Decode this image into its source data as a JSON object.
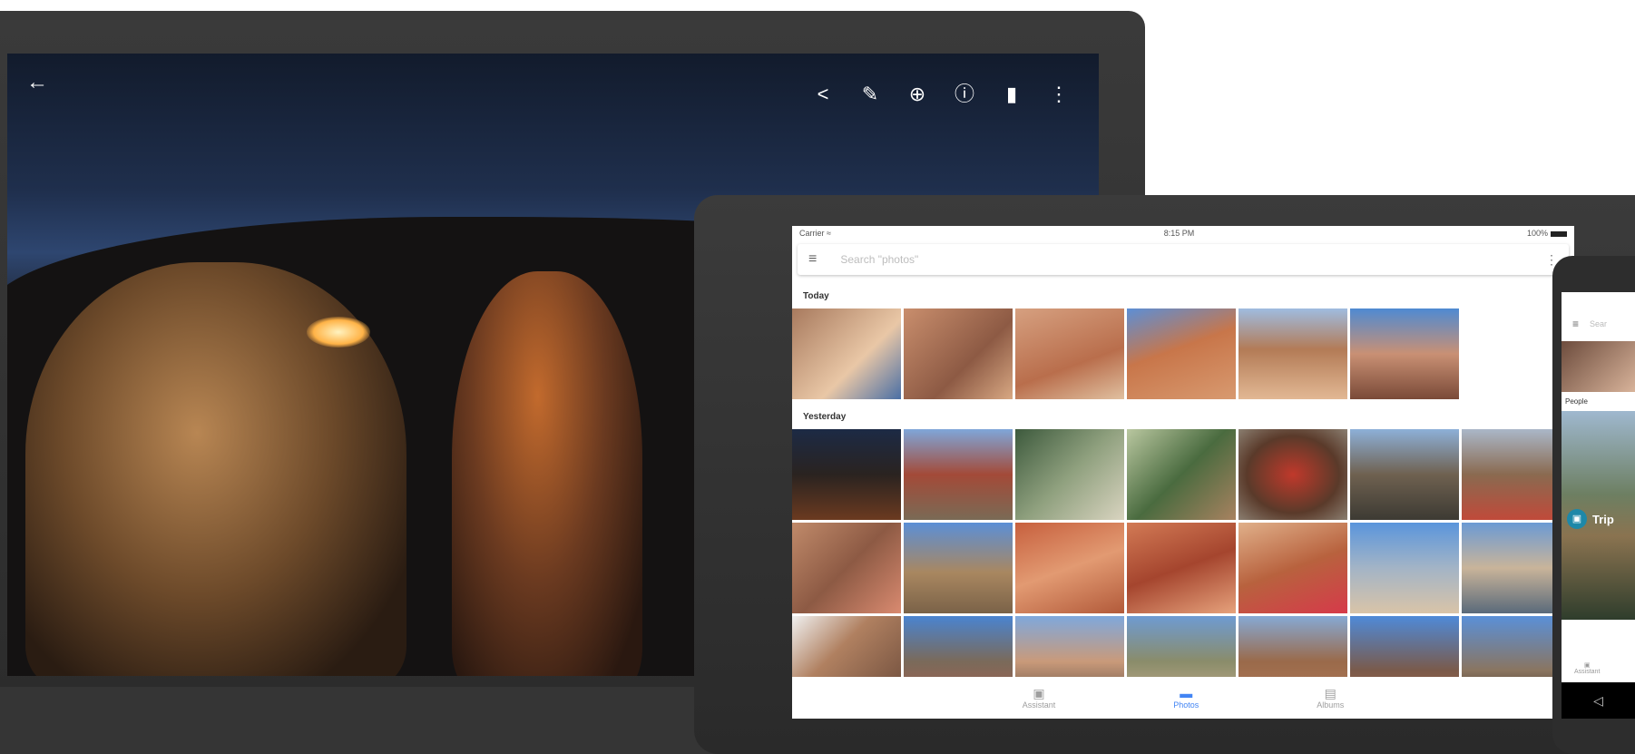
{
  "laptop": {
    "back_icon": "arrow-left-icon",
    "toolbar": [
      {
        "name": "share-icon",
        "glyph": "<"
      },
      {
        "name": "edit-icon",
        "glyph": "✎"
      },
      {
        "name": "zoom-icon",
        "glyph": "⊕"
      },
      {
        "name": "info-icon",
        "glyph": "ⓘ"
      },
      {
        "name": "delete-icon",
        "glyph": "▮"
      },
      {
        "name": "more-vert-icon",
        "glyph": "⋮"
      }
    ]
  },
  "tablet": {
    "status": {
      "carrier": "Carrier ≈",
      "time": "8:15 PM",
      "battery": "100%"
    },
    "search_placeholder": "Search \"photos\"",
    "sections": [
      {
        "title": "Today",
        "count": 6
      },
      {
        "title": "Yesterday",
        "count": 21
      }
    ],
    "bottom_nav": [
      {
        "label": "Assistant",
        "icon": "assistant-icon",
        "active": false
      },
      {
        "label": "Photos",
        "icon": "photos-icon",
        "active": true
      },
      {
        "label": "Albums",
        "icon": "albums-icon",
        "active": false
      }
    ]
  },
  "phone": {
    "search_placeholder": "Sear",
    "people_label": "People",
    "chip_title": "Trip",
    "bottom_label": "Assistant",
    "back_glyph": "◁"
  },
  "colors": {
    "accent": "#4285f4",
    "device": "#2b2b2b"
  }
}
